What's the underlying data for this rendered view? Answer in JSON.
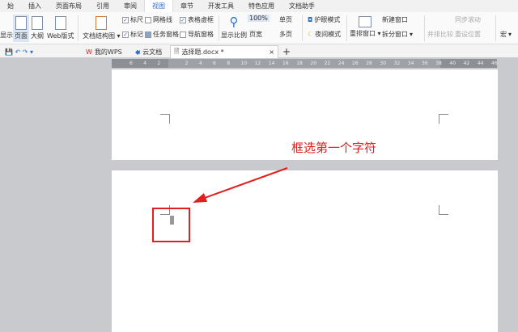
{
  "menu": [
    "始",
    "插入",
    "页面布局",
    "引用",
    "审阅",
    "视图",
    "章节",
    "开发工具",
    "特色应用",
    "文档助手"
  ],
  "ribbon": {
    "show": "显示",
    "page": "页面",
    "outline": "大纲",
    "web": "Web版式",
    "doc_structure": "文档结构图",
    "ruler": "标尺",
    "gridlines": "网格线",
    "table_gridlines": "表格虚框",
    "marks": "标记",
    "task_pane": "任务窗格",
    "nav_pane": "导航窗格",
    "zoom": "显示比例",
    "zoom_value": "100%",
    "page_width": "页宽",
    "single_page": "单页",
    "multi_page": "多页",
    "eye_mode": "护眼模式",
    "night_mode": "夜间模式",
    "rearrange": "重排窗口",
    "new_window": "新建窗口",
    "split": "拆分窗口",
    "side_by_side": "并排比较",
    "sync_scroll": "同步滚动",
    "reset_pos": "重设位置",
    "macro": "宏"
  },
  "tabs": {
    "wps": "我的WPS",
    "cloud": "云文档",
    "doc": "选择题.docx *",
    "add": "+"
  },
  "ruler_labels": [
    "6",
    "4",
    "2",
    "2",
    "4",
    "6",
    "8",
    "10",
    "12",
    "14",
    "16",
    "18",
    "20",
    "22",
    "24",
    "26",
    "28",
    "30",
    "32",
    "34",
    "36",
    "38",
    "40",
    "42",
    "44",
    "46"
  ],
  "annotation": "框选第一个字符",
  "colors": {
    "accent": "#2a6fd0",
    "annotation": "#e02020"
  }
}
